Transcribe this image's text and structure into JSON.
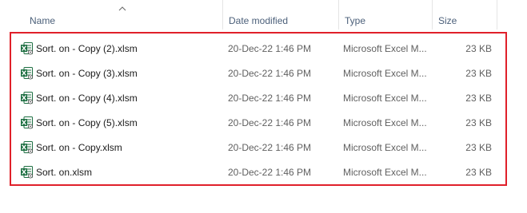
{
  "columns": {
    "name": "Name",
    "date_modified": "Date modified",
    "type": "Type",
    "size": "Size"
  },
  "sort": {
    "column": "name",
    "direction": "ascending"
  },
  "files": [
    {
      "name": "Sort. on - Copy (2).xlsm",
      "date": "20-Dec-22 1:46 PM",
      "type": "Microsoft Excel M...",
      "size": "23 KB",
      "icon": "excel-macro-file-icon"
    },
    {
      "name": "Sort. on - Copy (3).xlsm",
      "date": "20-Dec-22 1:46 PM",
      "type": "Microsoft Excel M...",
      "size": "23 KB",
      "icon": "excel-macro-file-icon"
    },
    {
      "name": "Sort. on - Copy (4).xlsm",
      "date": "20-Dec-22 1:46 PM",
      "type": "Microsoft Excel M...",
      "size": "23 KB",
      "icon": "excel-macro-file-icon"
    },
    {
      "name": "Sort. on - Copy (5).xlsm",
      "date": "20-Dec-22 1:46 PM",
      "type": "Microsoft Excel M...",
      "size": "23 KB",
      "icon": "excel-macro-file-icon"
    },
    {
      "name": "Sort. on - Copy.xlsm",
      "date": "20-Dec-22 1:46 PM",
      "type": "Microsoft Excel M...",
      "size": "23 KB",
      "icon": "excel-macro-file-icon"
    },
    {
      "name": "Sort. on.xlsm",
      "date": "20-Dec-22 1:46 PM",
      "type": "Microsoft Excel M...",
      "size": "23 KB",
      "icon": "excel-macro-file-icon"
    }
  ],
  "colors": {
    "annotation_border": "#e0202a",
    "excel_green": "#1d6f42",
    "header_text": "#4c607a"
  }
}
